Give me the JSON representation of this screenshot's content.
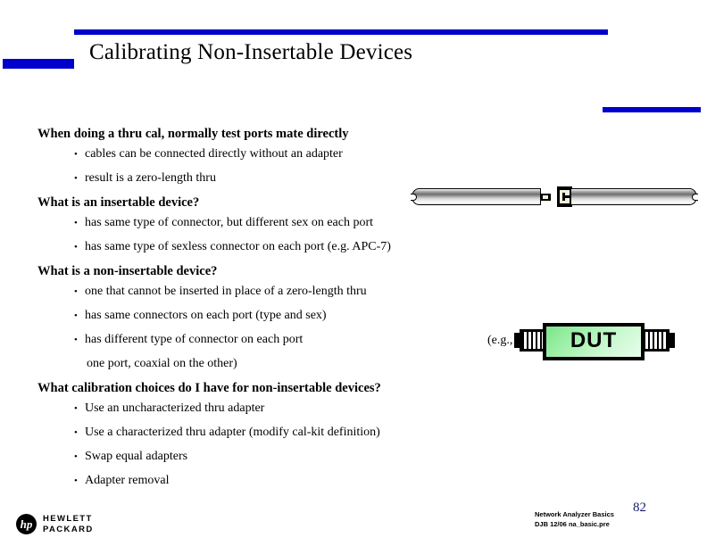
{
  "slide": {
    "title": "Calibrating Non-Insertable Devices",
    "accent_color": "#0000CC",
    "page_number": "82"
  },
  "content": {
    "sections": [
      {
        "heading": "When doing a thru cal, normally test ports mate directly",
        "bullets": [
          "cables can be connected directly without an adapter",
          "result is a zero-length thru"
        ]
      },
      {
        "heading": "What is an insertable device?",
        "bullets": [
          "has same type of connector, but different sex on each port",
          "has same type of sexless connector on each port (e.g. APC-7)"
        ]
      },
      {
        "heading": "What is a non-insertable device?",
        "bullets": [
          "one that cannot be inserted in place of a zero-length thru",
          "has same connectors on each port (type and sex)",
          "has different type of connector on each port"
        ],
        "continuation": "one port, coaxial on the other)"
      },
      {
        "heading": "What calibration choices do I have for non-insertable devices?",
        "bullets": [
          "Use an uncharacterized thru adapter",
          "Use a characterized thru adapter (modify cal-kit definition)",
          "Swap equal adapters",
          "Adapter removal"
        ]
      }
    ],
    "bullet_glyph": "•"
  },
  "figures": {
    "cable": {
      "name": "mating-test-port-cables",
      "left_connector_type": "male-pin",
      "right_connector_type": "female-socket"
    },
    "dut": {
      "prefix_label": "(e.g.,",
      "device_label": "DUT",
      "body_color": "#9DF0A8"
    }
  },
  "footer": {
    "logo_mark": "hp",
    "brand_line1": "HEWLETT",
    "brand_line2": "PACKARD",
    "note_line1": "Network Analyzer Basics",
    "note_line2": "DJB  12/06  na_basic.pre"
  }
}
